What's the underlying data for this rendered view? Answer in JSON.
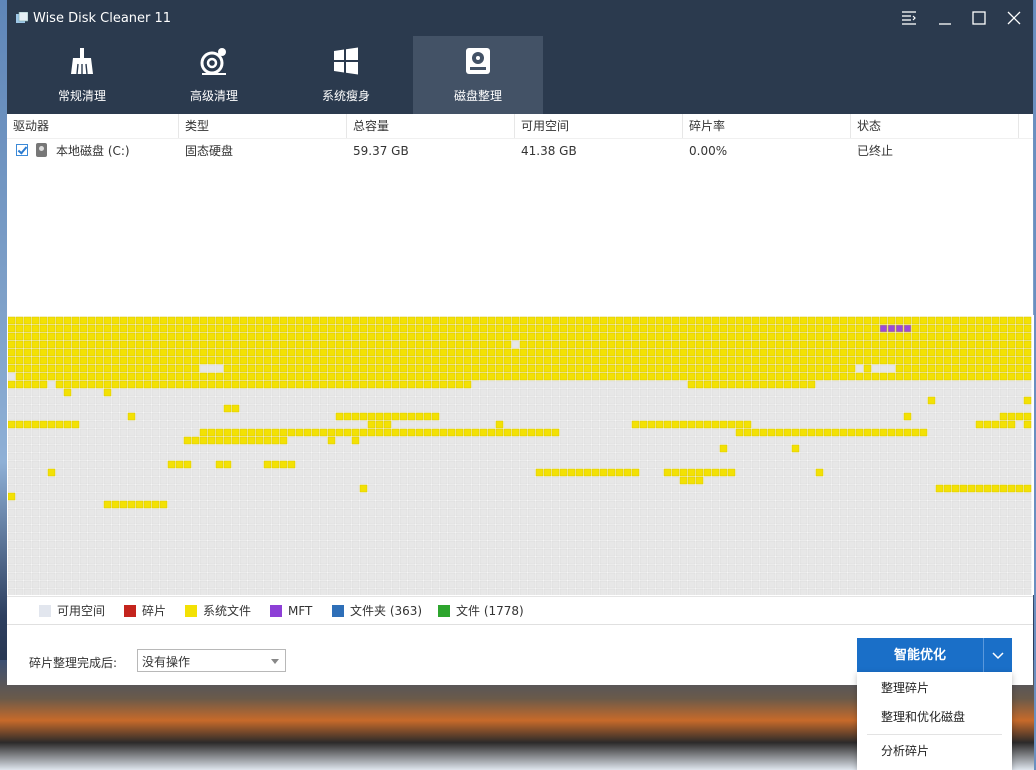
{
  "window": {
    "title": "Wise Disk Cleaner 11"
  },
  "nav": {
    "tabs": [
      {
        "label": "常规清理",
        "icon": "broom-icon"
      },
      {
        "label": "高级清理",
        "icon": "advanced-clean-icon"
      },
      {
        "label": "系统瘦身",
        "icon": "windows-icon"
      },
      {
        "label": "磁盘整理",
        "icon": "disk-defrag-icon",
        "active": true
      }
    ]
  },
  "table": {
    "columns": [
      "驱动器",
      "类型",
      "总容量",
      "可用空间",
      "碎片率",
      "状态"
    ],
    "rows": [
      {
        "drive": "本地磁盘 (C:)",
        "type": "固态硬盘",
        "total": "59.37 GB",
        "free": "41.38 GB",
        "frag": "0.00%",
        "status": "已终止",
        "checked": true
      }
    ]
  },
  "disk_map": {
    "cols": 128,
    "rows": 35,
    "colors": {
      "free": "#e7e7e7",
      "system": "#f3e104",
      "mft": "#9b4ad9"
    }
  },
  "legend": [
    {
      "label": "可用空间",
      "color": "#e2e6ee"
    },
    {
      "label": "碎片",
      "color": "#c4241d"
    },
    {
      "label": "系统文件",
      "color": "#f3e104"
    },
    {
      "label": "MFT",
      "color": "#8d3fd6"
    },
    {
      "label": "文件夹 (363)",
      "color": "#2e6fb8"
    },
    {
      "label": "文件 (1778)",
      "color": "#2ea52e"
    }
  ],
  "footer": {
    "after_label": "碎片整理完成后:",
    "after_value": "没有操作",
    "primary_button": "智能优化"
  },
  "dropdown_menu": {
    "items": [
      "整理碎片",
      "整理和优化磁盘",
      "分析碎片"
    ]
  }
}
